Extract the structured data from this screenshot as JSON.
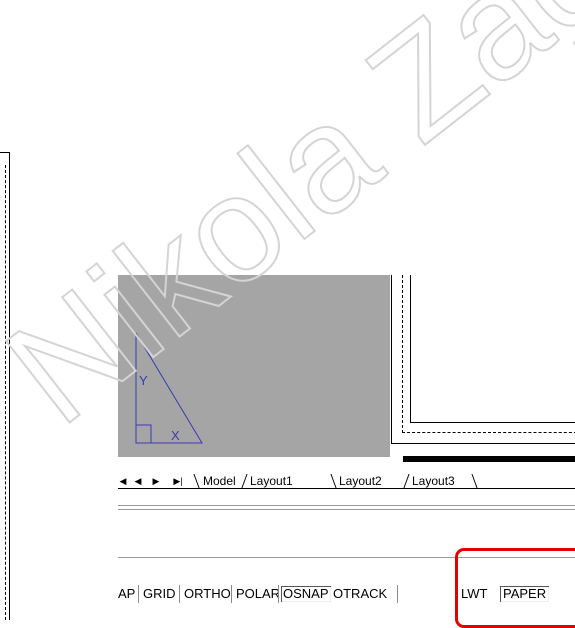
{
  "watermark": {
    "text": "Nikola Zagreb",
    "color": "#d8d8d8"
  },
  "layout_tabs": {
    "nav_buttons": [
      {
        "name": "first-tab-button",
        "glyph": "◀"
      },
      {
        "name": "prev-tab-button",
        "glyph": "◀"
      },
      {
        "name": "next-tab-button",
        "glyph": "▶"
      },
      {
        "name": "last-tab-button",
        "glyph": "▶|"
      }
    ],
    "tabs": [
      {
        "label": "Model",
        "active": false
      },
      {
        "label": "Layout1",
        "active": false
      },
      {
        "label": "Layout2",
        "active": true
      },
      {
        "label": "Layout3",
        "active": false
      }
    ]
  },
  "ucs_icon": {
    "x_label": "X",
    "y_label": "Y",
    "color": "#3b3bb0"
  },
  "status_bar": {
    "buttons": [
      {
        "label": "AP",
        "pressed": false
      },
      {
        "label": "GRID",
        "pressed": false
      },
      {
        "label": "ORTHO",
        "pressed": false
      },
      {
        "label": "POLAR",
        "pressed": false
      },
      {
        "label": "OSNAP",
        "pressed": true
      },
      {
        "label": "OTRACK",
        "pressed": false
      },
      {
        "label": "LWT",
        "pressed": false
      },
      {
        "label": "PAPER",
        "pressed": true
      }
    ]
  },
  "highlight": {
    "color": "#e00000"
  }
}
